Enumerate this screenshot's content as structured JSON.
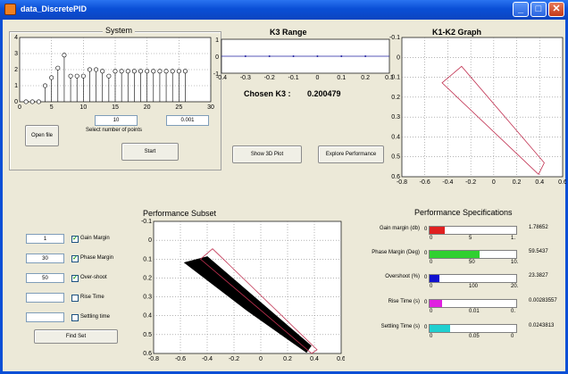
{
  "window": {
    "title": "data_DiscretePID"
  },
  "system": {
    "title": "System",
    "x_ticks": [
      "0",
      "5",
      "10",
      "15",
      "20",
      "25",
      "30"
    ],
    "y_ticks": [
      "0",
      "1",
      "2",
      "3",
      "4"
    ],
    "stem_values": [
      0,
      0,
      0,
      1,
      1.5,
      2.1,
      2.9,
      1.6,
      1.6,
      1.6,
      2,
      2,
      1.9,
      1.6,
      1.9,
      1.9,
      1.9,
      1.9,
      1.9,
      1.9,
      1.9,
      1.9,
      1.9,
      1.9,
      1.9,
      1.9
    ],
    "points_value": "10",
    "points_label": "Select number of points",
    "step_value": "0.001",
    "open_file": "Open file",
    "start": "Start"
  },
  "k3": {
    "title": "K3 Range",
    "x_ticks": [
      "-0.4",
      "-0.3",
      "-0.2",
      "-0.1",
      "0",
      "0.1",
      "0.2",
      "0.3"
    ],
    "y_ticks": [
      "1",
      "0",
      "-1"
    ],
    "chosen_label": "Chosen K3 :",
    "chosen_value": "0.200479"
  },
  "buttons": {
    "show3d": "Show 3D Plot",
    "explore": "Explore Performance",
    "find_set": "Find Set"
  },
  "k1k2": {
    "title": "K1-K2 Graph",
    "x_ticks": [
      "-0.8",
      "-0.6",
      "-0.4",
      "-0.2",
      "0",
      "0.2",
      "0.4",
      "0.6"
    ],
    "y_ticks": [
      "0.6",
      "0.5",
      "0.4",
      "0.3",
      "0.2",
      "0.1",
      "0",
      "-0.1"
    ]
  },
  "subset": {
    "title": "Performance Subset",
    "x_ticks": [
      "-0.8",
      "-0.6",
      "-0.4",
      "-0.2",
      "0",
      "0.2",
      "0.4",
      "0.6"
    ],
    "y_ticks": [
      "0.6",
      "0.5",
      "0.4",
      "0.3",
      "0.2",
      "0.1",
      "0",
      "-0.1"
    ]
  },
  "criteria": [
    {
      "value": "1",
      "label": "Gain Margin",
      "checked": true
    },
    {
      "value": "30",
      "label": "Phase Margin",
      "checked": true
    },
    {
      "value": "50",
      "label": "Over-shoot",
      "checked": true
    },
    {
      "value": "",
      "label": "Rise Time",
      "checked": false
    },
    {
      "value": "",
      "label": "Settling time",
      "checked": false
    }
  ],
  "specs": {
    "title": "Performance Specifications",
    "rows": [
      {
        "label": "Gain margin (db)",
        "value": "1.78652",
        "fraction": 0.18,
        "color": "#e02020",
        "ticks": [
          "0",
          "5",
          "1."
        ]
      },
      {
        "label": "Phase Margin (Deg)",
        "value": "59.5437",
        "fraction": 0.58,
        "color": "#30d030",
        "ticks": [
          "0",
          "50",
          "10."
        ]
      },
      {
        "label": "Overshoot (%)",
        "value": "23.3827",
        "fraction": 0.11,
        "color": "#1010d0",
        "ticks": [
          "0",
          "100",
          "20."
        ]
      },
      {
        "label": "Rise Time (s)",
        "value": "0.00283557",
        "fraction": 0.14,
        "color": "#e020e0",
        "ticks": [
          "0",
          "0.01",
          "0."
        ]
      },
      {
        "label": "Settling Time (s)",
        "value": "0.0243813",
        "fraction": 0.24,
        "color": "#20d0d0",
        "ticks": [
          "0",
          "0.05",
          "0"
        ]
      }
    ]
  }
}
